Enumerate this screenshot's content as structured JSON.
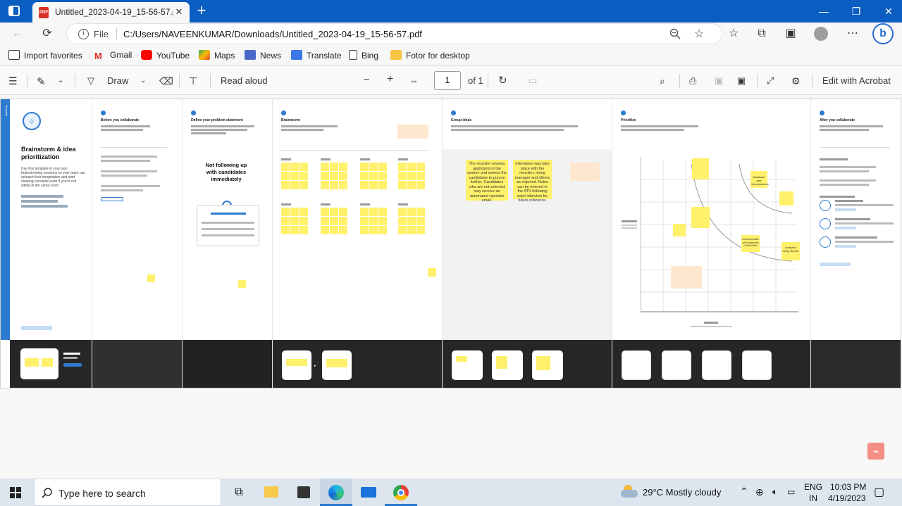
{
  "browser": {
    "tab_title": "Untitled_2023-04-19_15-56-57.p",
    "tab_badge": "PDF",
    "new_tab": "+",
    "close_glyph": "✕",
    "url_scheme_label": "File",
    "url": "C:/Users/NAVEENKUMAR/Downloads/Untitled_2023-04-19_15-56-57.pdf",
    "favorites": [
      "Import favorites",
      "Gmail",
      "YouTube",
      "Maps",
      "News",
      "Translate",
      "Bing",
      "Fotor for desktop"
    ]
  },
  "pdf_toolbar": {
    "draw": "Draw",
    "read_aloud": "Read aloud",
    "minus": "−",
    "plus": "+",
    "page": "1",
    "of": "of 1",
    "edit_acrobat": "Edit with Acrobat"
  },
  "document": {
    "side_tab": "Template",
    "intro_title": "Brainstorm & idea prioritization",
    "intro_body": "Use this template in your own brainstorming sessions so your team can unleash their imagination and start shaping concepts even if you're not sitting in the same room.",
    "panels": [
      {
        "title": "Before you collaborate"
      },
      {
        "title": "Define your problem statement"
      },
      {
        "title": "Brainstorm"
      },
      {
        "title": "Group ideas"
      },
      {
        "title": "Prioritize"
      },
      {
        "title": "After you collaborate"
      }
    ],
    "problem_statement": "Not following up with candidates immediately",
    "idea_notes": [
      "The recruiter reviews applicants in the system and selects the candidates to pursue further. Candidates who are not selected may receive an automated rejection email.",
      "Interviews may take place with the recruiter, hiring manager and others as required. Notes can be entered in the ATS following each interview for future reference."
    ],
    "priority_notes": [
      "Database and Spreadsheets",
      "Analytics doing Report",
      "Communication with Applicants or Recruiters"
    ]
  },
  "taskbar": {
    "search_placeholder": "Type here to search",
    "weather": "29°C  Mostly cloudy",
    "lang_top": "ENG",
    "lang_bottom": "IN",
    "time": "10:03 PM",
    "date": "4/19/2023"
  },
  "colors": {
    "titlebar": "#0a5ec2",
    "sticky": "#fff16b",
    "dark_band": "#262626",
    "accent": "#2d7bd0"
  }
}
